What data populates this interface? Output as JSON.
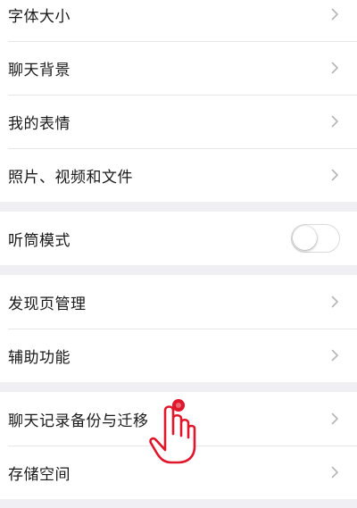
{
  "settings": {
    "group1": [
      {
        "label": "字体大小"
      },
      {
        "label": "聊天背景"
      },
      {
        "label": "我的表情"
      },
      {
        "label": "照片、视频和文件"
      }
    ],
    "group2": [
      {
        "label": "听筒模式",
        "toggle_on": false
      }
    ],
    "group3": [
      {
        "label": "发现页管理"
      },
      {
        "label": "辅助功能"
      }
    ],
    "group4": [
      {
        "label": "聊天记录备份与迁移"
      },
      {
        "label": "存储空间"
      }
    ]
  },
  "icons": {
    "row_chevron": "chevron-right-icon",
    "tap_pointer": "hand-pointer-icon"
  },
  "colors": {
    "background": "#efeff4",
    "row_background": "#ffffff",
    "text": "#1a1a1a",
    "chevron": "#b5b5b5",
    "tap_indicator": "#e0162b"
  }
}
